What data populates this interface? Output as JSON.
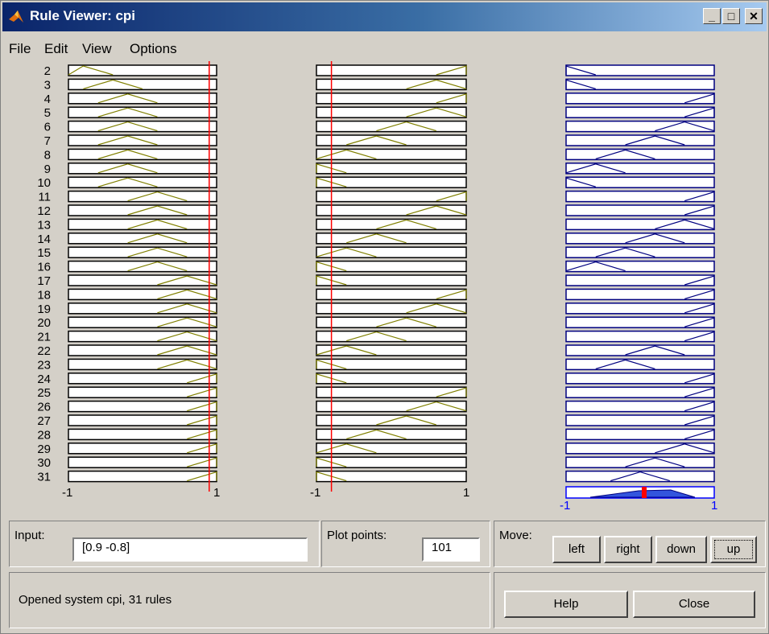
{
  "window": {
    "title": "Rule Viewer: cpi"
  },
  "menu": [
    "File",
    "Edit",
    "View",
    "Options"
  ],
  "rules": [
    "2",
    "3",
    "4",
    "5",
    "6",
    "7",
    "8",
    "9",
    "10",
    "11",
    "12",
    "13",
    "14",
    "15",
    "16",
    "17",
    "18",
    "19",
    "20",
    "21",
    "22",
    "23",
    "24",
    "25",
    "26",
    "27",
    "28",
    "29",
    "30",
    "31"
  ],
  "axes": {
    "input1": {
      "min": "-1",
      "max": "1",
      "value": 0.9
    },
    "input2": {
      "min": "-1",
      "max": "1",
      "value": -0.8
    },
    "output": {
      "min": "-1",
      "max": "1"
    }
  },
  "input": {
    "label": "Input:",
    "value": "[0.9 -0.8]"
  },
  "plot_points": {
    "label": "Plot points:",
    "value": "101"
  },
  "move": {
    "label": "Move:",
    "buttons": [
      "left",
      "right",
      "down",
      "up"
    ]
  },
  "status": "Opened system cpi, 31 rules",
  "actions": {
    "help": "Help",
    "close": "Close"
  },
  "colors": {
    "title_start": "#0a246a",
    "title_end": "#a6caf0",
    "face": "#d4d0c8",
    "input_mf": "#808000",
    "input_fill": "#ffff00",
    "output_mf": "#000080",
    "output_fill": "#3355dd",
    "crisp_line": "#ff0000",
    "output_axis": "#0000ff"
  }
}
